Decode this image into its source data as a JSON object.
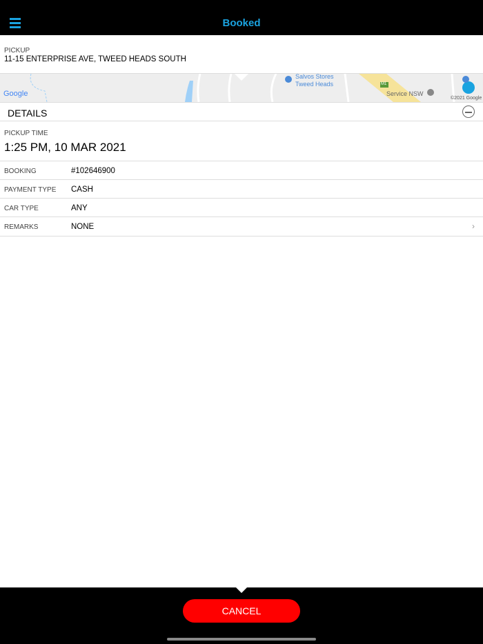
{
  "header": {
    "title": "Booked"
  },
  "pickup": {
    "label": "PICKUP",
    "address": "11-15 ENTERPRISE AVE, TWEED HEADS SOUTH"
  },
  "map": {
    "labels": [
      "Salvos Stores",
      "Tweed Heads",
      "Service NSW",
      "M1"
    ],
    "logo": "Google",
    "copyright": "©2021 Google"
  },
  "details": {
    "heading": "DETAILS",
    "pickup_time_label": "PICKUP TIME",
    "pickup_time": "1:25 PM, 10 MAR 2021",
    "rows": [
      {
        "label": "BOOKING",
        "value": "#102646900"
      },
      {
        "label": "PAYMENT TYPE",
        "value": "CASH"
      },
      {
        "label": "CAR TYPE",
        "value": "ANY"
      },
      {
        "label": "REMARKS",
        "value": "NONE"
      }
    ]
  },
  "footer": {
    "cancel_label": "CANCEL"
  }
}
